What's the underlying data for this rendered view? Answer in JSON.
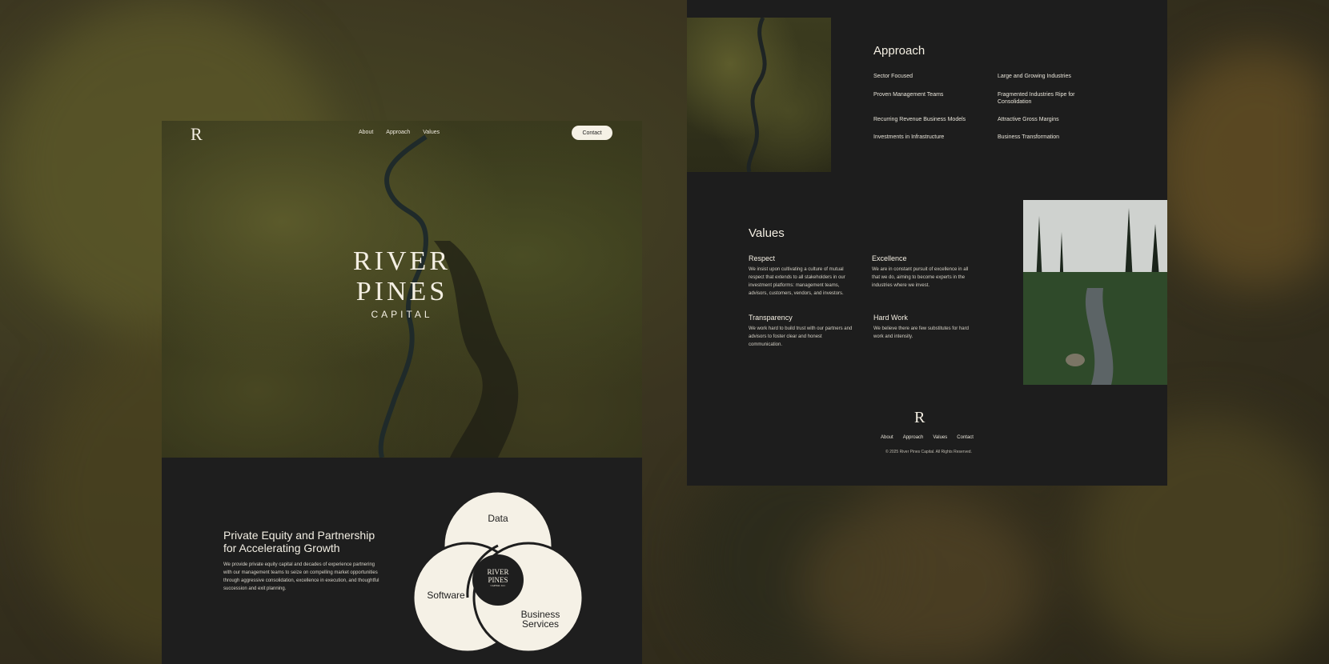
{
  "left_page": {
    "nav": {
      "logo": "R",
      "items": [
        "About",
        "Approach",
        "Values"
      ],
      "contact_label": "Contact"
    },
    "hero_logo": {
      "line1": "RIVER",
      "line2": "PINES",
      "line3": "CAPITAL"
    },
    "intro": {
      "heading": "Private Equity and Partnership for Accelerating Growth",
      "body": "We provide private equity capital and decades of experience partnering with our management teams to seize on compelling market opportunities through aggressive consolidation, excellence in execution, and thoughtful succession and exit planning."
    },
    "venn": {
      "top": "Data",
      "left": "Software",
      "right_line1": "Business",
      "right_line2": "Services",
      "center_line1": "RIVER",
      "center_line2": "PINES",
      "center_line3": "CAPITAL LLC"
    }
  },
  "right_page": {
    "approach": {
      "title": "Approach",
      "items": [
        "Sector Focused",
        "Large and Growing Industries",
        "Proven Management Teams",
        "Fragmented Industries Ripe for Consolidation",
        "Recurring Revenue Business Models",
        "Attractive Gross Margins",
        "Investments in Infrastructure",
        "Business Transformation"
      ]
    },
    "values": {
      "title": "Values",
      "items": [
        {
          "title": "Respect",
          "text": "We insist upon cultivating a culture of mutual respect that extends to all stakeholders in our investment platforms: management teams, advisors, customers, vendors, and investors."
        },
        {
          "title": "Excellence",
          "text": "We are in constant pursuit of excellence in all that we do, aiming to become experts in the industries where we invest."
        },
        {
          "title": "Transparency",
          "text": "We work hard to build trust with our partners and advisors to foster clear and honest communication."
        },
        {
          "title": "Hard Work",
          "text": "We believe there are few substitutes for hard work and intensity."
        }
      ]
    },
    "footer": {
      "logo": "R",
      "nav": [
        "About",
        "Approach",
        "Values",
        "Contact"
      ],
      "copyright": "© 2025 River Pines Capital. All Rights Reserved."
    }
  },
  "colors": {
    "page_bg": "#1e1e1e",
    "cream": "#f5f1e6",
    "text_light": "#f4efe3"
  }
}
